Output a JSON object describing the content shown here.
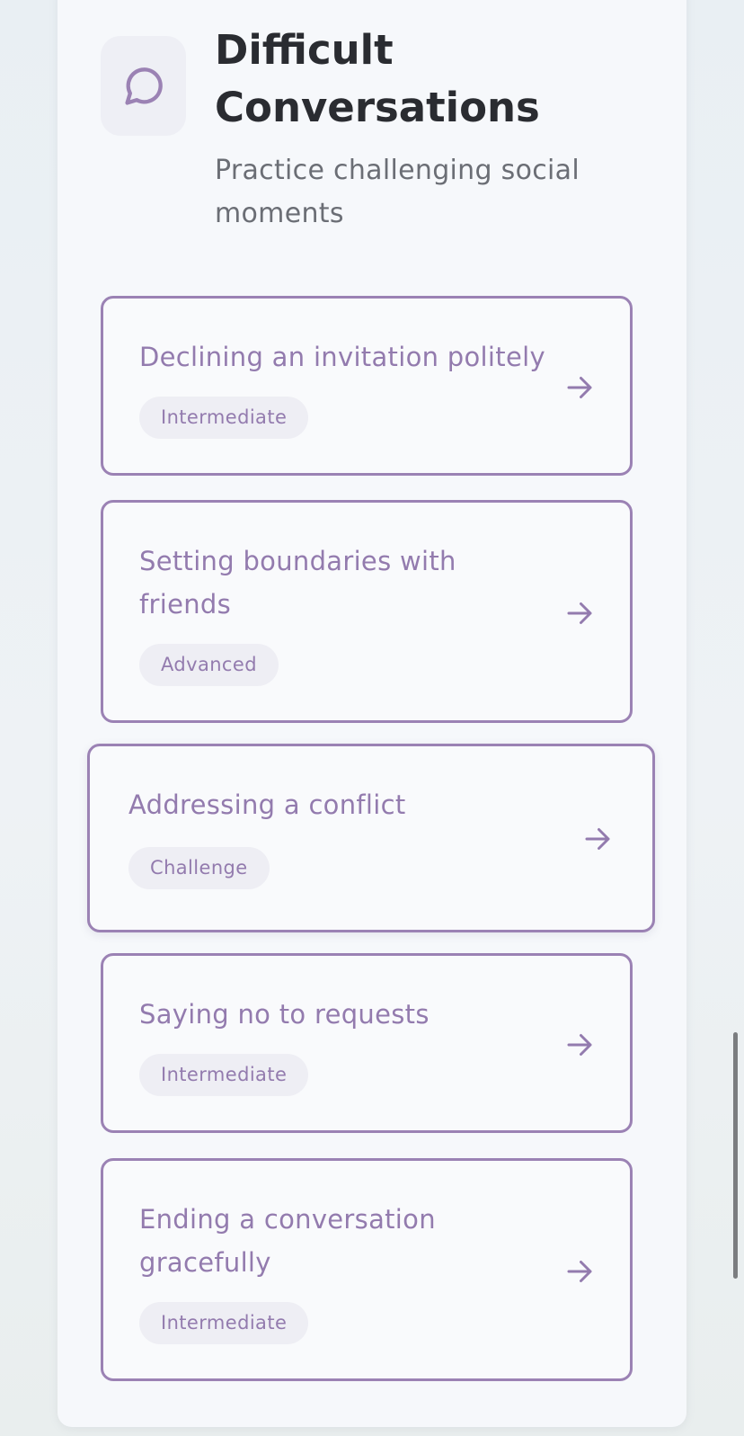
{
  "section": {
    "title": "Difficult Conversations",
    "subtitle": "Practice challenging social moments",
    "icon": "speech-bubble-icon"
  },
  "colors": {
    "accent": "#9b82b4",
    "text_accent": "#937bae",
    "badge_bg": "#eeeef4",
    "title": "#2a2c31",
    "subtitle": "#6b6e75"
  },
  "scenarios": [
    {
      "title": "Declining an invitation politely",
      "level": "Intermediate"
    },
    {
      "title": "Setting boundaries with friends",
      "level": "Advanced"
    },
    {
      "title": "Addressing a conflict",
      "level": "Challenge"
    },
    {
      "title": "Saying no to requests",
      "level": "Intermediate"
    },
    {
      "title": "Ending a conversation gracefully",
      "level": "Intermediate"
    }
  ]
}
